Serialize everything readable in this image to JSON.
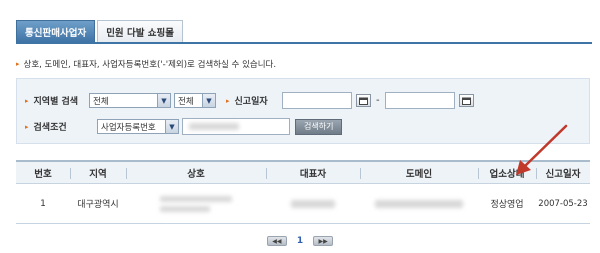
{
  "tabs": [
    {
      "label": "통신판매사업자",
      "active": true
    },
    {
      "label": "민원 다발 쇼핑몰",
      "active": false
    }
  ],
  "notice": "상호, 도메인, 대표자, 사업자등록번호('-'제외)로 검색하실 수 있습니다.",
  "search": {
    "region_label": "지역별 검색",
    "region_select_1": "전체",
    "region_select_2": "전체",
    "date_label": "신고일자",
    "date_separator": "-",
    "condition_label": "검색조건",
    "condition_select": "사업자등록번호",
    "search_button": "검색하기"
  },
  "table": {
    "headers": [
      "번호",
      "지역",
      "상호",
      "대표자",
      "도메인",
      "업소상태",
      "신고일자"
    ],
    "rows": [
      {
        "no": "1",
        "region": "대구광역시",
        "status": "정상영업",
        "date": "2007-05-23"
      }
    ]
  },
  "pager": {
    "current": "1"
  },
  "colors": {
    "tab_active": "#3f74a6",
    "annotation_arrow": "#c0392b",
    "search_bg": "#eef3f8"
  }
}
